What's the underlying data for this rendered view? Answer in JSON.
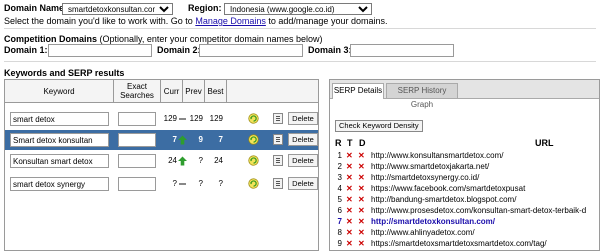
{
  "header": {
    "domain_name_label": "Domain Name:",
    "domain_selected": "smartdetoxkonsultan.com",
    "region_label": "Region:",
    "region_selected": "Indonesia (www.google.co.id)",
    "instruction_pre": "Select the domain you'd like to work with. Go to",
    "manage_link": "Manage Domains",
    "instruction_post": "to add/manage your domains."
  },
  "competition": {
    "title": "Competition Domains",
    "subtitle": "(Optionally, enter your competitor domain names below)",
    "domain1_label": "Domain 1:",
    "domain2_label": "Domain 2:",
    "domain3_label": "Domain 3:",
    "domain1_value": "",
    "domain2_value": "",
    "domain3_value": ""
  },
  "keywords": {
    "section_title": "Keywords and SERP results",
    "columns": {
      "keyword": "Keyword",
      "exact": "Exact Searches",
      "curr": "Curr",
      "prev": "Prev",
      "best": "Best"
    },
    "delete_label": "Delete",
    "rows": [
      {
        "keyword": "smart detox",
        "exact": "",
        "curr": "129",
        "trend": "flat",
        "prev": "129",
        "best": "129",
        "selected": false
      },
      {
        "keyword": "Smart detox konsultan",
        "exact": "",
        "curr": "7",
        "trend": "up",
        "prev": "9",
        "best": "7",
        "selected": true
      },
      {
        "keyword": "Konsultan smart detox",
        "exact": "",
        "curr": "24",
        "trend": "up",
        "prev": "?",
        "best": "24",
        "selected": false
      },
      {
        "keyword": "smart detox synergy",
        "exact": "",
        "curr": "?",
        "trend": "flat",
        "prev": "?",
        "best": "?",
        "selected": false
      }
    ]
  },
  "serp": {
    "tabs": [
      "SERP Details",
      "SERP History Graph"
    ],
    "check_button": "Check Keyword Density",
    "columns": {
      "r": "R",
      "t": "T",
      "d": "D",
      "url": "URL"
    },
    "results": [
      {
        "rank": "1",
        "url": "http://www.konsultansmartdetox.com/",
        "highlight": false
      },
      {
        "rank": "2",
        "url": "http://www.smartdetoxjakarta.net/",
        "highlight": false
      },
      {
        "rank": "3",
        "url": "http://smartdetoxsynergy.co.id/",
        "highlight": false
      },
      {
        "rank": "4",
        "url": "https://www.facebook.com/smartdetoxpusat",
        "highlight": false
      },
      {
        "rank": "5",
        "url": "http://bandung-smartdetox.blogspot.com/",
        "highlight": false
      },
      {
        "rank": "6",
        "url": "http://www.prosesdetox.com/konsultan-smart-detox-terbaik-d",
        "highlight": false
      },
      {
        "rank": "7",
        "url": "http://smartdetoxkonsultan.com/",
        "highlight": true
      },
      {
        "rank": "8",
        "url": "http://www.ahlinyadetox.com/",
        "highlight": false
      },
      {
        "rank": "9",
        "url": "https://smartdetoxsmartdetoxsmartdetox.com/tag/",
        "highlight": false
      }
    ]
  },
  "colors": {
    "selected_row": "#3c6da3",
    "link": "#1a0dab",
    "x_mark": "#cc0000",
    "up_arrow": "#2e9d2e",
    "refresh": "#3a9a20"
  }
}
